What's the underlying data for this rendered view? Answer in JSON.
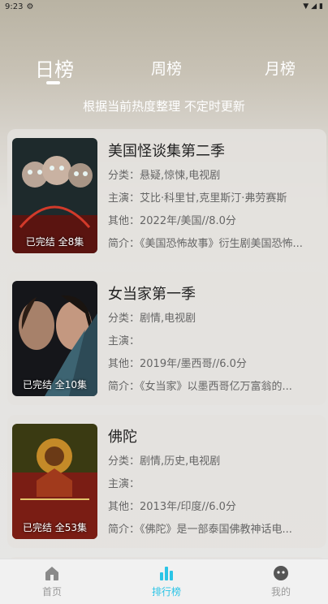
{
  "status_bar": {
    "time": "9:23"
  },
  "tabs": {
    "day": "日榜",
    "week": "周榜",
    "month": "月榜"
  },
  "subtitle": "根据当前热度整理 不定时更新",
  "items": [
    {
      "title": "美国怪谈集第二季",
      "genre": "分类：悬疑,惊悚,电视剧",
      "cast": "主演：艾比·科里甘,克里斯汀·弗劳赛斯",
      "other": "其他：2022年/美国//8.0分",
      "intro": "简介：《美国恐怖故事》衍生剧美国恐怖...",
      "badge": "已完结 全8集"
    },
    {
      "title": "女当家第一季",
      "genre": "分类：剧情,电视剧",
      "cast": "主演：",
      "other": "其他：2019年/墨西哥//6.0分",
      "intro": "简介：《女当家》以墨西哥亿万富翁的...",
      "badge": "已完结 全10集"
    },
    {
      "title": "佛陀",
      "genre": "分类：剧情,历史,电视剧",
      "cast": "主演：",
      "other": "其他：2013年/印度//6.0分",
      "intro": "简介：《佛陀》是一部泰国佛教神话电...",
      "badge": "已完结 全53集"
    }
  ],
  "nav": {
    "home": "首页",
    "rank": "排行榜",
    "mine": "我的"
  },
  "colors": {
    "accent": "#2bc4e6"
  }
}
